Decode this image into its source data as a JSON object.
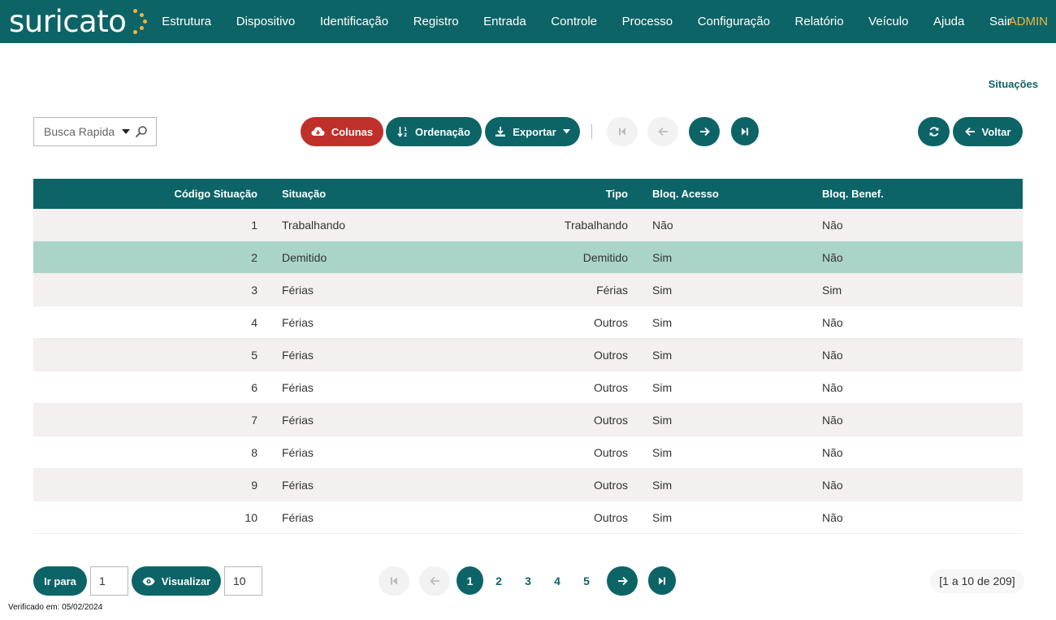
{
  "app": {
    "logo": "suricato",
    "user": "ADMIN",
    "page_title": "Situações"
  },
  "nav": [
    {
      "label": "Estrutura"
    },
    {
      "label": "Dispositivo"
    },
    {
      "label": "Identificação"
    },
    {
      "label": "Registro"
    },
    {
      "label": "Entrada"
    },
    {
      "label": "Controle"
    },
    {
      "label": "Processo"
    },
    {
      "label": "Configuração"
    },
    {
      "label": "Relatório"
    },
    {
      "label": "Veículo"
    },
    {
      "label": "Ajuda"
    },
    {
      "label": "Sair"
    }
  ],
  "toolbar": {
    "search_placeholder": "Busca Rapida",
    "columns_label": "Colunas",
    "sort_label": "Ordenação",
    "export_label": "Exportar",
    "back_label": "Voltar"
  },
  "table": {
    "columns": [
      "Código Situação",
      "Situação",
      "Tipo",
      "Bloq. Acesso",
      "Bloq. Benef."
    ],
    "rows": [
      {
        "codigo": "1",
        "situacao": "Trabalhando",
        "tipo": "Trabalhando",
        "bloq_acesso": "Não",
        "bloq_benef": "Não"
      },
      {
        "codigo": "2",
        "situacao": "Demitido",
        "tipo": "Demitido",
        "bloq_acesso": "Sim",
        "bloq_benef": "Não"
      },
      {
        "codigo": "3",
        "situacao": "Férias",
        "tipo": "Férias",
        "bloq_acesso": "Sim",
        "bloq_benef": "Sim"
      },
      {
        "codigo": "4",
        "situacao": "Férias",
        "tipo": "Outros",
        "bloq_acesso": "Sim",
        "bloq_benef": "Não"
      },
      {
        "codigo": "5",
        "situacao": "Férias",
        "tipo": "Outros",
        "bloq_acesso": "Sim",
        "bloq_benef": "Não"
      },
      {
        "codigo": "6",
        "situacao": "Férias",
        "tipo": "Outros",
        "bloq_acesso": "Sim",
        "bloq_benef": "Não"
      },
      {
        "codigo": "7",
        "situacao": "Férias",
        "tipo": "Outros",
        "bloq_acesso": "Sim",
        "bloq_benef": "Não"
      },
      {
        "codigo": "8",
        "situacao": "Férias",
        "tipo": "Outros",
        "bloq_acesso": "Sim",
        "bloq_benef": "Não"
      },
      {
        "codigo": "9",
        "situacao": "Férias",
        "tipo": "Outros",
        "bloq_acesso": "Sim",
        "bloq_benef": "Não"
      },
      {
        "codigo": "10",
        "situacao": "Férias",
        "tipo": "Outros",
        "bloq_acesso": "Sim",
        "bloq_benef": "Não"
      }
    ]
  },
  "footer": {
    "goto_label": "Ir para",
    "goto_value": "1",
    "view_label": "Visualizar",
    "view_value": "10",
    "pages": [
      "1",
      "2",
      "3",
      "4",
      "5"
    ],
    "current_page": "1",
    "record_count": "[1 a 10 de 209]",
    "verified": "Verificado em: 05/02/2024"
  },
  "colors": {
    "primary": "#0d6467",
    "danger": "#c0302a",
    "accent": "#f2b33d",
    "row_selected": "#aad4c8",
    "row_odd": "#f4f0ef"
  },
  "icons": {
    "search": "search-icon",
    "columns": "cloud-download-icon",
    "sort": "sort-icon",
    "export": "download-icon",
    "first": "first-page-icon",
    "prev": "arrow-left-icon",
    "next": "arrow-right-icon",
    "last": "last-page-icon",
    "refresh": "refresh-icon",
    "view": "eye-icon"
  }
}
